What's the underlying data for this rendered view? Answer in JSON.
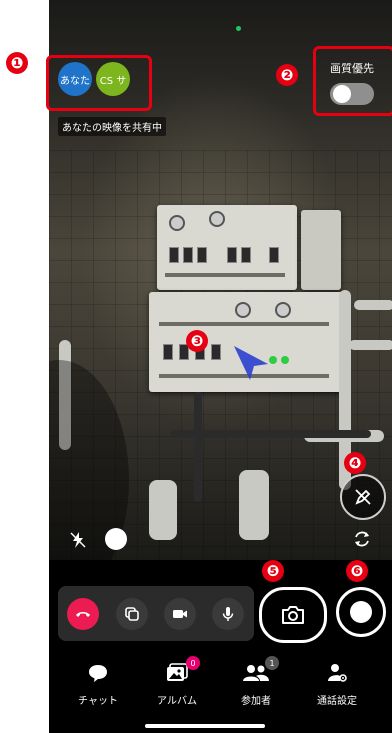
{
  "participants": [
    {
      "label": "あなた",
      "color": "#1f74c9"
    },
    {
      "label": "CS サ",
      "color": "#7cb51e"
    }
  ],
  "sharing_label": "あなたの映像を共有中",
  "high_quality": {
    "label": "画質優先",
    "enabled": false
  },
  "callouts": [
    "❶",
    "❷",
    "❸",
    "❹",
    "❺",
    "❻"
  ],
  "callout_color": "#e60012",
  "controls": {
    "end_call_color": "#ec1c52",
    "icons": [
      "phone-hangup-icon",
      "screen-share-icon",
      "video-camera-icon",
      "microphone-icon"
    ]
  },
  "capture": {
    "photo_icon": "camera-icon",
    "record_icon": "record-icon"
  },
  "nav": [
    {
      "label": "チャット",
      "icon": "chat-bubble-icon",
      "badge": ""
    },
    {
      "label": "アルバム",
      "icon": "album-icon",
      "badge": "0",
      "badge_color": "#e6006f"
    },
    {
      "label": "参加者",
      "icon": "participants-icon",
      "badge": "1",
      "badge_color": "#555555"
    },
    {
      "label": "通話設定",
      "icon": "call-settings-icon",
      "badge": ""
    }
  ]
}
